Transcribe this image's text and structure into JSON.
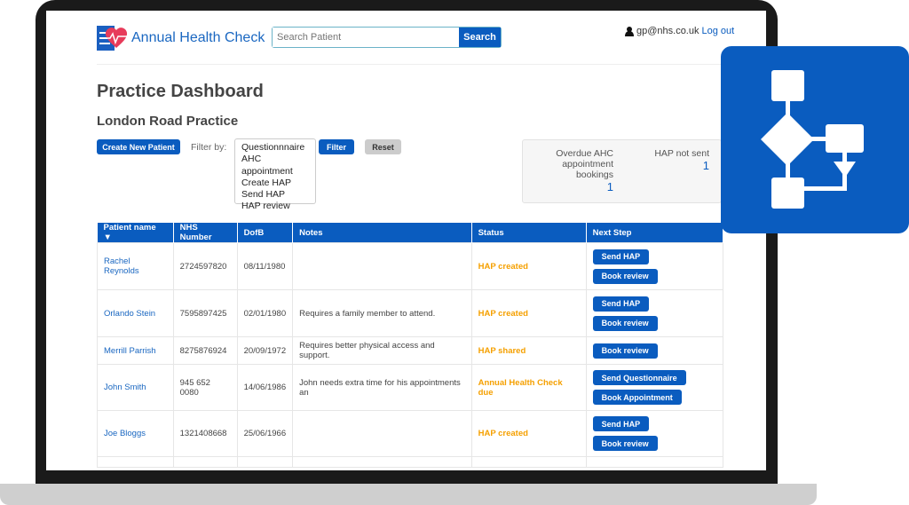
{
  "header": {
    "app_title": "Annual Health Check",
    "search_placeholder": "Search Patient",
    "search_button": "Search",
    "user_email": "gp@nhs.co.uk",
    "logout": "Log out"
  },
  "page": {
    "title": "Practice Dashboard",
    "practice": "London Road Practice"
  },
  "toolbar": {
    "create_patient": "Create New Patient",
    "filter_label": "Filter by:",
    "filter_options": [
      "Questionnnaire",
      "AHC appointment",
      "Create HAP",
      "Send HAP",
      "HAP review"
    ],
    "filter_button": "Filter",
    "reset_button": "Reset"
  },
  "stats": [
    {
      "label": "Overdue AHC appointment bookings",
      "value": "1"
    },
    {
      "label": "HAP not sent",
      "value": "1"
    }
  ],
  "table": {
    "columns": [
      "Patient name ▼",
      "NHS Number",
      "DofB",
      "Notes",
      "Status",
      "Next Step"
    ],
    "rows": [
      {
        "name": "Rachel Reynolds",
        "nhs": "2724597820",
        "dob": "08/11/1980",
        "notes": "",
        "status": "HAP created",
        "actions": [
          "Send HAP",
          "Book review"
        ]
      },
      {
        "name": "Orlando Stein",
        "nhs": "7595897425",
        "dob": "02/01/1980",
        "notes": "Requires a family member to attend.",
        "status": "HAP created",
        "actions": [
          "Send HAP",
          "Book review"
        ]
      },
      {
        "name": "Merrill Parrish",
        "nhs": "8275876924",
        "dob": "20/09/1972",
        "notes": "Requires better physical access and support.",
        "status": "HAP shared",
        "actions": [
          "Book review"
        ]
      },
      {
        "name": "John Smith",
        "nhs": "945 652 0080",
        "dob": "14/06/1986",
        "notes": "John needs extra time for his appointments an",
        "status": "Annual Health Check due",
        "actions": [
          "Send Questionnaire",
          "Book Appointment"
        ]
      },
      {
        "name": "Joe Bloggs",
        "nhs": "1321408668",
        "dob": "25/06/1966",
        "notes": "",
        "status": "HAP created",
        "actions": [
          "Send HAP",
          "Book review"
        ]
      }
    ]
  },
  "colors": {
    "brand": "#0a5cbf",
    "status": "#f5a000",
    "bezel": "#1a1a1a"
  },
  "icons": {
    "logo": "clipboard-heart-icon",
    "user": "user-icon",
    "badge": "flowchart-icon"
  }
}
